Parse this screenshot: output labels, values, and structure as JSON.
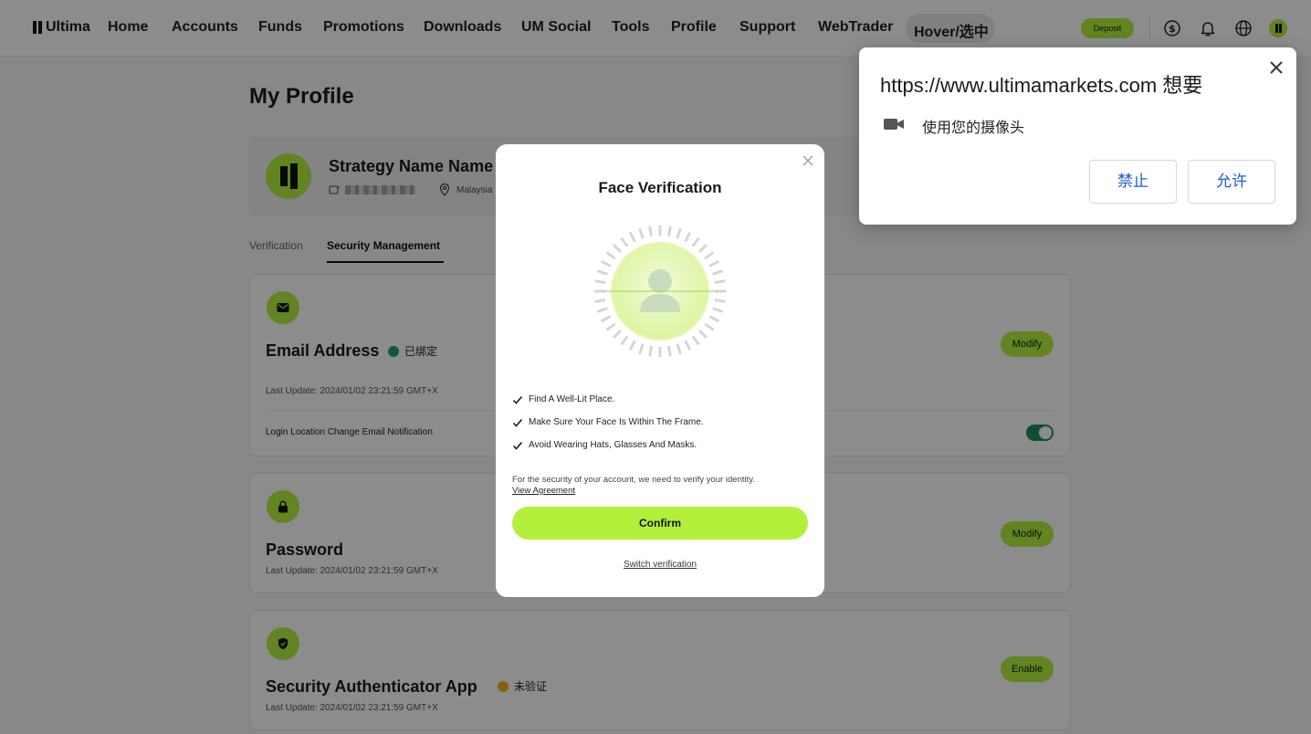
{
  "nav": {
    "logo": "Ultima",
    "items": [
      "Home",
      "Accounts",
      "Funds",
      "Promotions",
      "Downloads",
      "UM Social",
      "Tools",
      "Profile",
      "Support",
      "WebTrader",
      "Hover/选中"
    ],
    "deposit_label": "Deposit",
    "icons": [
      "dollar-icon",
      "bell-icon",
      "globe-icon",
      "avatar"
    ]
  },
  "page": {
    "title": "My Profile",
    "profile": {
      "name": "Strategy Name Name",
      "country": "Malaysia"
    },
    "tabs": [
      "Verification",
      "Security Management"
    ],
    "active_tab": "Security Management",
    "cards": {
      "email": {
        "title": "Email Address",
        "status": "已绑定",
        "last_update": "Last Update: 2024/01/02 23:21:59 GMT+X",
        "button": "Modify",
        "notification_label": "Login Location Change Email Notification"
      },
      "password": {
        "title": "Password",
        "last_update": "Last Update: 2024/01/02 23:21:59 GMT+X",
        "button": "Modify"
      },
      "authenticator": {
        "title": "Security Authenticator App",
        "status": "未验证",
        "last_update": "Last Update: 2024/01/02 23:21:59 GMT+X",
        "button": "Enable"
      }
    }
  },
  "modal": {
    "title": "Face Verification",
    "checks": [
      "Find A Well-Lit Place.",
      "Make Sure Your Face Is Within The Frame.",
      "Avoid Wearing Hats, Glasses And Masks."
    ],
    "note": "For the security of your account, we need to verify your identity.",
    "agreement_link": "View Agreement",
    "confirm_label": "Confirm",
    "switch_label": "Switch verification"
  },
  "permission": {
    "title": "https://www.ultimamarkets.com 想要",
    "description": "使用您的摄像头",
    "block_label": "禁止",
    "allow_label": "允许"
  },
  "colors": {
    "accent": "#b3f03c",
    "toggle_on": "#1f8f5a",
    "verified": "#1aa36b",
    "pending": "#f2b515",
    "link_blue": "#1a5dd0"
  }
}
